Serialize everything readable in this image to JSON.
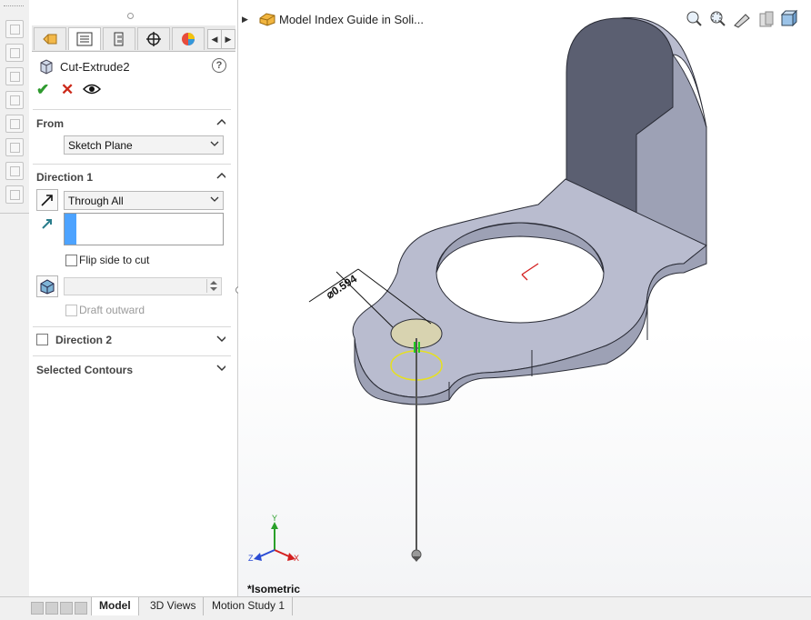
{
  "feature_manager": {
    "title": "Model Index Guide in Soli...",
    "tabs": [
      "feature-manager",
      "property-manager",
      "configuration-manager",
      "dimxpert-manager",
      "display-manager"
    ]
  },
  "property_manager": {
    "title": "Cut-Extrude2",
    "help": "?",
    "ok_symbol": "✔",
    "cancel_symbol": "✕",
    "from": {
      "header": "From",
      "start_condition": "Sketch Plane"
    },
    "direction1": {
      "header": "Direction 1",
      "end_condition": "Through All",
      "direction_value": "",
      "flip_side_label": "Flip side to cut",
      "draft_angle_value": "",
      "draft_outward_label": "Draft outward"
    },
    "direction2": {
      "header": "Direction 2"
    },
    "selected_contours": {
      "header": "Selected Contours"
    }
  },
  "viewport": {
    "dimension_label": "⌀0.594",
    "view_label": "*Isometric",
    "axis_labels": {
      "x": "X",
      "y": "Y",
      "z": "Z"
    }
  },
  "bottom_tabs": [
    "Model",
    "3D Views",
    "Motion Study 1"
  ],
  "colors": {
    "accept": "#2e9a2e",
    "cancel": "#cc2a1a",
    "part_face": "#b9bccf",
    "part_side": "#9da1b5",
    "part_dark": "#5b5f71",
    "selection_yellow": "#e6e01f",
    "sketch_face": "#d8d3b0",
    "direction_blue": "#4da3ff"
  }
}
